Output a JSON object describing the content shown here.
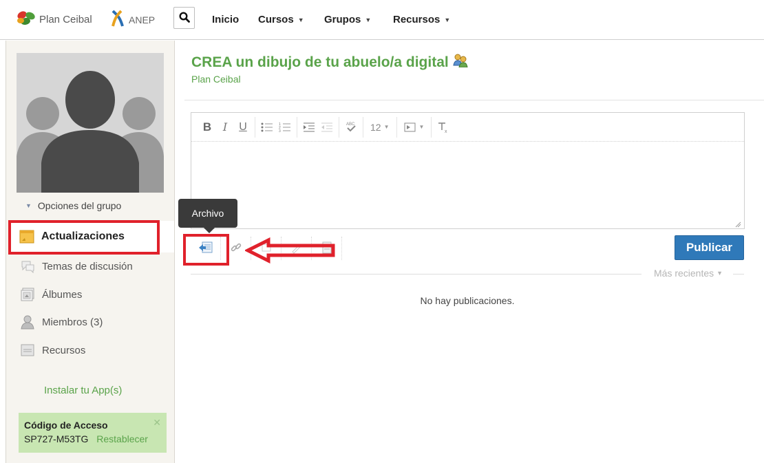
{
  "header": {
    "brand_ceibal": "Plan Ceibal",
    "brand_anep": "ANEP",
    "nav": {
      "inicio": "Inicio",
      "cursos": "Cursos",
      "grupos": "Grupos",
      "recursos": "Recursos"
    }
  },
  "sidebar": {
    "options_label": "Opciones del grupo",
    "items": [
      {
        "label": "Actualizaciones"
      },
      {
        "label": "Temas de discusión"
      },
      {
        "label": "Álbumes"
      },
      {
        "label": "Miembros (3)"
      },
      {
        "label": "Recursos"
      }
    ],
    "install_app": "Instalar tu App(s)",
    "access": {
      "title": "Código de Acceso",
      "code": "SP727-M53TG",
      "reset": "Restablecer"
    }
  },
  "main": {
    "title": "CREA un dibujo de tu abuelo/a digital",
    "subtitle": "Plan Ceibal",
    "editor": {
      "font_size": "12",
      "tooltip": "Archivo"
    },
    "publish_label": "Publicar",
    "sort_label": "Más recientes",
    "empty_message": "No hay publicaciones."
  },
  "colors": {
    "accent_green": "#5aa34a",
    "primary_blue": "#2f79b9",
    "highlight_red": "#e0212b",
    "access_bg": "#c8e6b2"
  },
  "icons": {
    "search": "search-icon",
    "file": "file-attach-icon",
    "link": "link-icon",
    "group": "group-people-icon"
  }
}
